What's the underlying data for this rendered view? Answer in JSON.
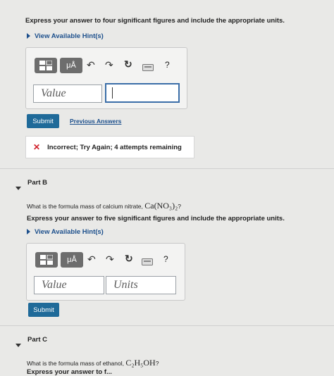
{
  "partA": {
    "instruction": "Express your answer to four significant figures and include the appropriate units.",
    "hints_label": "View Available Hint(s)",
    "value_placeholder": "Value",
    "submit_label": "Submit",
    "previous_answers_label": "Previous Answers",
    "feedback_icon": "✕",
    "feedback_text": "Incorrect; Try Again; 4 attempts remaining"
  },
  "toolbar": {
    "templates_icon": "templates-icon",
    "units_label": "μÅ",
    "undo_icon": "↶",
    "redo_icon": "↷",
    "reset_icon": "↻",
    "keyboard_icon": "keyboard-icon",
    "help_label": "?"
  },
  "partB": {
    "title": "Part B",
    "question_prefix": "What is the formula mass of calcium nitrate, ",
    "formula": "Ca(NO₃)₂",
    "question_suffix": "?",
    "instruction": "Express your answer to five significant figures and include the appropriate units.",
    "hints_label": "View Available Hint(s)",
    "value_placeholder": "Value",
    "units_placeholder": "Units",
    "submit_label": "Submit"
  },
  "partC": {
    "title": "Part C",
    "question_prefix": "What is the formula mass of ethanol, ",
    "formula": "C₂H₅OH",
    "question_suffix": "?",
    "instruction_partial": "Express your answer to f..."
  }
}
